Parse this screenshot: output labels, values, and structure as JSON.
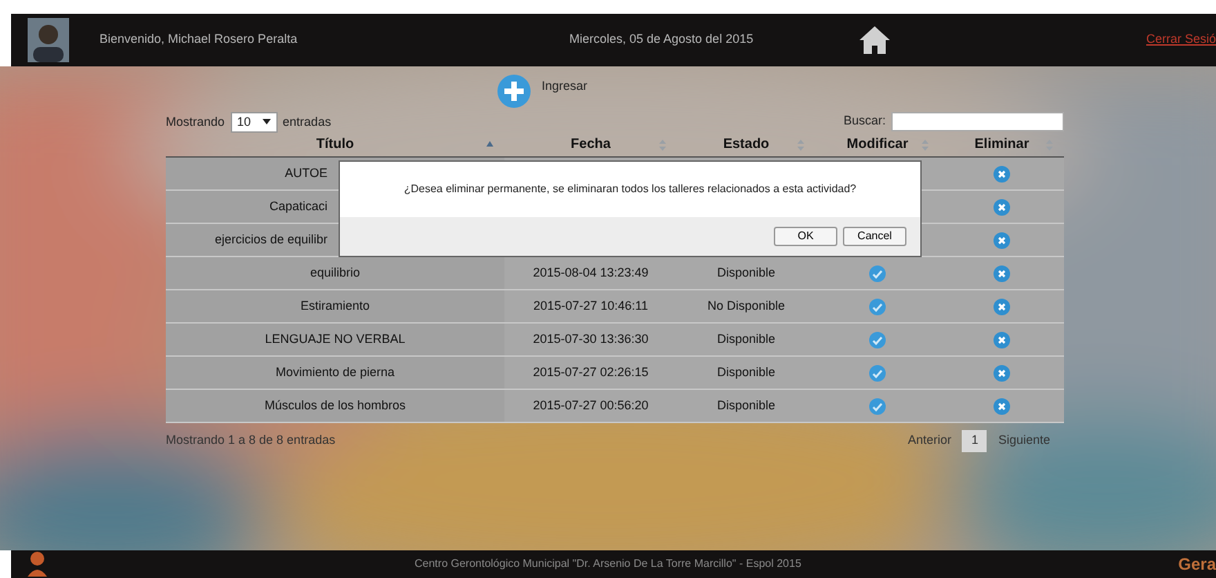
{
  "header": {
    "welcome": "Bienvenido, Michael Rosero Peralta",
    "date": "Miercoles, 05 de Agosto del 2015",
    "logout": "Cerrar Sesió"
  },
  "toolbar": {
    "add_label": "Ingresar",
    "length_prefix": "Mostrando",
    "length_value": "10",
    "length_suffix": "entradas",
    "search_label": "Buscar:"
  },
  "table": {
    "columns": [
      {
        "label": "Título",
        "sorted": true
      },
      {
        "label": "Fecha",
        "sorted": false
      },
      {
        "label": "Estado",
        "sorted": false
      },
      {
        "label": "Modificar",
        "sorted": false
      },
      {
        "label": "Eliminar",
        "sorted": false
      }
    ],
    "rows": [
      {
        "title": "AUTOE"
      },
      {
        "title": "Capaticaci"
      },
      {
        "title": "ejercicios de equilibr"
      },
      {
        "title": "equilibrio",
        "date": "2015-08-04 13:23:49",
        "status": "Disponible"
      },
      {
        "title": "Estiramiento",
        "date": "2015-07-27 10:46:11",
        "status": "No Disponible"
      },
      {
        "title": "LENGUAJE NO VERBAL",
        "date": "2015-07-30 13:36:30",
        "status": "Disponible"
      },
      {
        "title": "Movimiento de pierna",
        "date": "2015-07-27 02:26:15",
        "status": "Disponible"
      },
      {
        "title": "Músculos de los hombros",
        "date": "2015-07-27 00:56:20",
        "status": "Disponible"
      }
    ]
  },
  "info": "Mostrando 1 a 8 de 8 entradas",
  "pagination": {
    "previous": "Anterior",
    "pages": [
      {
        "label": "1",
        "selected": true
      }
    ],
    "next": "Siguiente"
  },
  "dialog": {
    "message": "¿Desea eliminar permanente, se eliminaran todos los talleres relacionados a esta actividad?",
    "buttons": [
      "OK",
      "Cancel"
    ]
  },
  "footer": {
    "text": "Centro Gerontológico Municipal \"Dr. Arsenio De La Torre Marcillo\" - Espol 2015",
    "logo": "Gera"
  }
}
